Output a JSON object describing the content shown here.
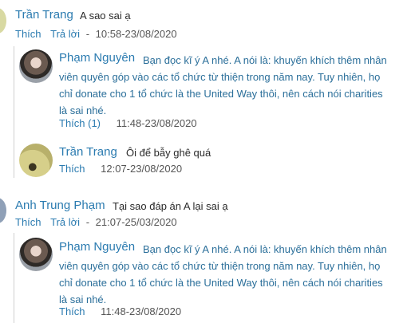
{
  "comments": [
    {
      "name": "Trần Trang",
      "text": "A sao sai ạ",
      "like": "Thích",
      "reply": "Trả lời",
      "sep": "-",
      "time": "10:58-23/08/2020",
      "replies": [
        {
          "name": "Phạm Nguyên",
          "text_lines": [
            "Bạn đọc kĩ ý A nhé. A nói là: khuyến khích thêm nhân",
            "viên quyên góp vào các tổ chức từ thiện trong năm nay. Tuy nhiên, họ",
            "chỉ donate cho 1 tổ chức là the United Way thôi, nên cách nói charities",
            "là sai nhé."
          ],
          "like": "Thích (1)",
          "time": "11:48-23/08/2020"
        },
        {
          "name": "Trần Trang",
          "text_lines": [
            "Ôi để bẫy ghê quá"
          ],
          "like": "Thích",
          "time": "12:07-23/08/2020"
        }
      ]
    },
    {
      "name": "Anh Trung Phạm",
      "text": "Tại sao đáp án A lại sai ạ",
      "like": "Thích",
      "reply": "Trả lời",
      "sep": "-",
      "time": "21:07-25/03/2020",
      "replies": [
        {
          "name": "Phạm Nguyên",
          "text_lines": [
            "Bạn đọc kĩ ý A nhé. A nói là: khuyến khích thêm nhân",
            "viên quyên góp vào các tổ chức từ thiện trong năm nay. Tuy nhiên, họ",
            "chỉ donate cho 1 tổ chức là the United Way thôi, nên cách nói charities",
            "là sai nhé."
          ],
          "like": "Thích",
          "time": "11:48-23/08/2020"
        }
      ]
    }
  ]
}
